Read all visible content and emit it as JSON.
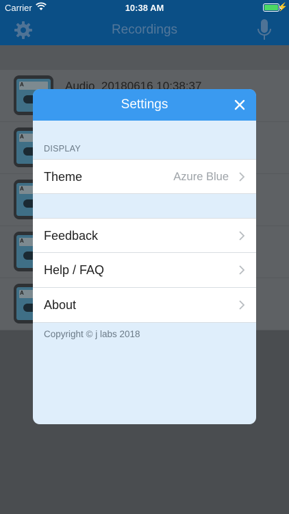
{
  "status_bar": {
    "carrier": "Carrier",
    "time": "10:38 AM"
  },
  "nav": {
    "title": "Recordings"
  },
  "recordings": [
    {
      "name": "Audio_20180616 10:38:37"
    },
    {
      "name": ""
    },
    {
      "name": ""
    },
    {
      "name": ""
    },
    {
      "name": ""
    }
  ],
  "settings": {
    "title": "Settings",
    "section_display": "DISPLAY",
    "theme_label": "Theme",
    "theme_value": "Azure Blue",
    "feedback_label": "Feedback",
    "help_label": "Help / FAQ",
    "about_label": "About",
    "copyright": "Copyright © j labs 2018"
  },
  "colors": {
    "accent": "#3a9af0",
    "nav_bar": "#0b4f86",
    "modal_bg": "#dfeefb",
    "battery": "#4cd964"
  },
  "icons": [
    "wifi-icon",
    "battery-icon",
    "gear-icon",
    "microphone-icon",
    "close-icon",
    "chevron-right-icon",
    "cassette-icon"
  ]
}
